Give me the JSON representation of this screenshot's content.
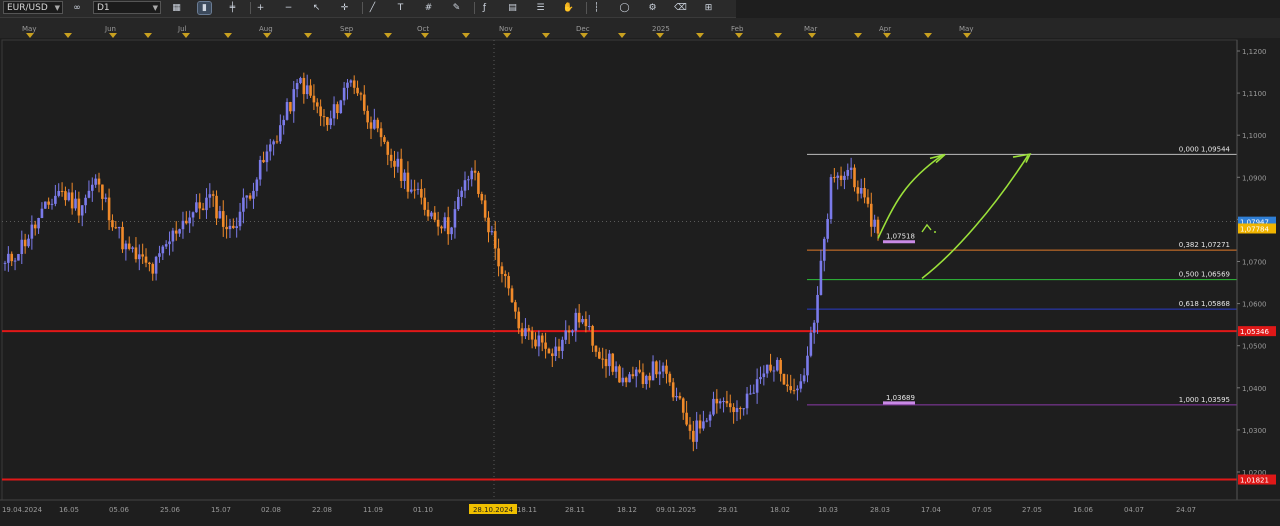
{
  "toolbar": {
    "symbol": "EUR/USD",
    "timeframe": "D1",
    "icons": [
      "chart-type-icon",
      "candles-icon",
      "bars-icon",
      "zoom-in-icon",
      "zoom-out-icon",
      "cursor-icon",
      "crosshair-icon",
      "trendline-icon",
      "text-tool-icon",
      "grid-icon",
      "pencil-icon",
      "indicators-icon",
      "template-icon",
      "objects-list-icon",
      "hand-icon",
      "period-separator-icon",
      "ellipse-icon",
      "settings-icon",
      "eraser-icon",
      "layout-icon"
    ]
  },
  "chart_data": {
    "type": "candlestick",
    "symbol": "EUR/USD",
    "timeframe": "D1",
    "ylim": [
      1.0175,
      1.1255
    ],
    "y_ticks": [
      "1,0200",
      "1,0300",
      "1,0400",
      "1,0500",
      "1,0600",
      "1,0700",
      "1,0800",
      "1,0900",
      "1,1000",
      "1,1100",
      "1,1200"
    ],
    "top_months": [
      "May",
      "Jun",
      "Jul",
      "Aug",
      "Sep",
      "Oct",
      "Nov",
      "Dec",
      "2025",
      "Feb",
      "Mar",
      "Apr",
      "May"
    ],
    "bottom_dates": [
      "19.04.2024",
      "16.05",
      "05.06",
      "25.06",
      "15.07",
      "02.08",
      "22.08",
      "11.09",
      "01.10",
      "28.10.2024",
      "18.11",
      "28.11",
      "18.12",
      "09.01.2025",
      "29.01",
      "18.02",
      "10.03",
      "28.03",
      "17.04",
      "07.05",
      "27.05",
      "16.06",
      "04.07",
      "24.07"
    ],
    "highlighted_date": "28.10.2024",
    "price_badges": [
      {
        "label": "1,07947",
        "value": 1.07947,
        "color": "#2f7fd6"
      },
      {
        "label": "1,07784",
        "value": 1.07784,
        "color": "#f0b400"
      },
      {
        "label": "1,05346",
        "value": 1.05346,
        "color": "#e01818"
      },
      {
        "label": "1,01821",
        "value": 1.01821,
        "color": "#e01818"
      }
    ],
    "fibonacci": [
      {
        "label": "0,000 1,09544",
        "level": 1.09544,
        "color": "#bdbdbd"
      },
      {
        "label": "0,382 1,07271",
        "level": 1.07271,
        "color": "#e07a2a"
      },
      {
        "label": "0,500 1,06569",
        "level": 1.06569,
        "color": "#2fbf3a"
      },
      {
        "label": "0,618 1,05868",
        "level": 1.05868,
        "color": "#2a3cc8"
      },
      {
        "label": "1,000 1,03595",
        "level": 1.03595,
        "color": "#8a3aa8"
      }
    ],
    "horizontal_lines": [
      {
        "value": 1.05346,
        "color": "#e01818"
      },
      {
        "value": 1.01821,
        "color": "#e01818"
      }
    ],
    "annotations": [
      {
        "label": "1,07518",
        "value": 1.07518
      },
      {
        "label": "1,03689",
        "value": 1.03689
      }
    ],
    "anchors": [
      [
        -1,
        1.068
      ],
      [
        6,
        1.075
      ],
      [
        16,
        1.087
      ],
      [
        22,
        1.083
      ],
      [
        27,
        1.089
      ],
      [
        36,
        1.073
      ],
      [
        44,
        1.068
      ],
      [
        52,
        1.079
      ],
      [
        61,
        1.085
      ],
      [
        67,
        1.077
      ],
      [
        82,
        1.102
      ],
      [
        88,
        1.113
      ],
      [
        96,
        1.102
      ],
      [
        103,
        1.114
      ],
      [
        112,
        1.098
      ],
      [
        125,
        1.083
      ],
      [
        132,
        1.078
      ],
      [
        139,
        1.092
      ],
      [
        153,
        1.054
      ],
      [
        164,
        1.049
      ],
      [
        171,
        1.057
      ],
      [
        176,
        1.05
      ],
      [
        185,
        1.041
      ],
      [
        195,
        1.045
      ],
      [
        205,
        1.029
      ],
      [
        212,
        1.038
      ],
      [
        219,
        1.034
      ],
      [
        228,
        1.046
      ],
      [
        236,
        1.04
      ],
      [
        238,
        1.044
      ],
      [
        241,
        1.055
      ],
      [
        246,
        1.088
      ],
      [
        252,
        1.092
      ],
      [
        256,
        1.083
      ],
      [
        260,
        1.0775
      ]
    ],
    "candle_colors": {
      "up": "#7b7bea",
      "down": "#f08a2a"
    }
  }
}
